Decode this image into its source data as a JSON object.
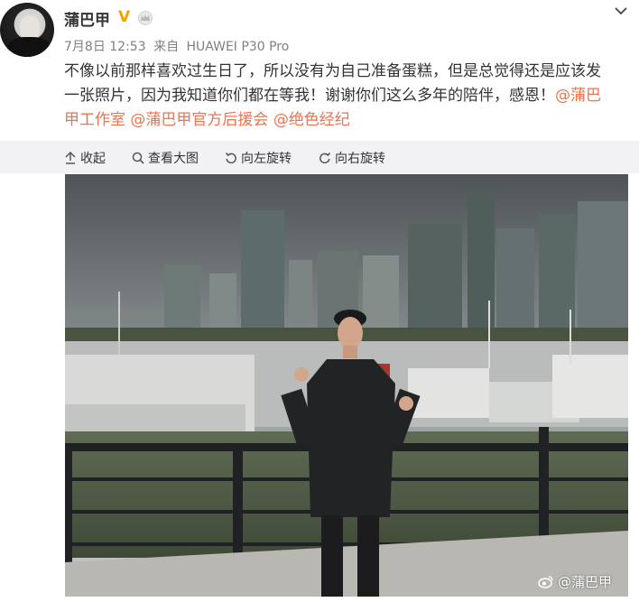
{
  "post": {
    "username": "蒲巴甲",
    "verified_badge": "V",
    "date": "7月8日 12:53",
    "source_prefix": "来自",
    "source_device": "HUAWEI P30 Pro",
    "text_line1": "不像以前那样喜欢过生日了，所以没有为自己准备蛋糕，但是总觉得还是应该发",
    "text_line2_plain": "一张照片，因为我知道你们都在等我！谢谢你们这么多年的陪伴，感恩！",
    "mention1_part1": "@蒲巴",
    "mention1_part2": "甲工作室",
    "mention2": "@蒲巴甲官方后援会",
    "mention3": "@绝色经纪"
  },
  "toolbar": {
    "collapse": "收起",
    "view_large": "查看大图",
    "rotate_left": "向左旋转",
    "rotate_right": "向右旋转"
  },
  "photo": {
    "watermark": "@蒲巴甲"
  },
  "colors": {
    "mention": "#eb7350",
    "badge": "#f5a300",
    "toolbar_bg": "#f2f2f5"
  },
  "icons": [
    "crown-icon",
    "chevron-down-icon",
    "arrow-up-icon",
    "search-icon",
    "rotate-left-icon",
    "rotate-right-icon",
    "weibo-icon"
  ]
}
